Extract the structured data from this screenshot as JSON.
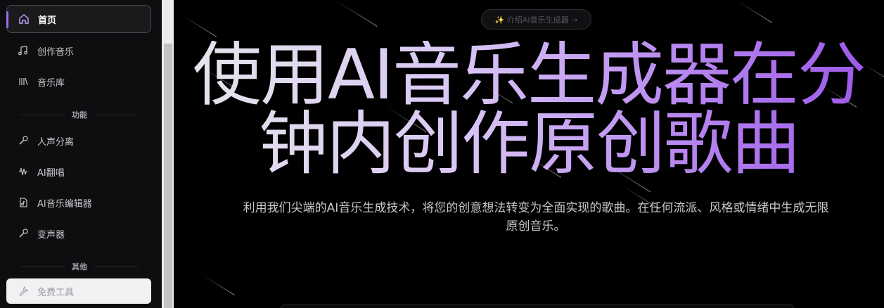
{
  "sidebar": {
    "nav": [
      {
        "label": "首页",
        "icon": "home-icon"
      },
      {
        "label": "创作音乐",
        "icon": "music-note-icon"
      },
      {
        "label": "音乐库",
        "icon": "library-icon"
      }
    ],
    "section_features": "功能",
    "features": [
      {
        "label": "人声分离",
        "icon": "split-icon"
      },
      {
        "label": "AI翻唱",
        "icon": "waveform-icon"
      },
      {
        "label": "AI音乐编辑器",
        "icon": "audio-file-icon"
      },
      {
        "label": "变声器",
        "icon": "voice-changer-icon"
      }
    ],
    "section_other": "其他",
    "other": [
      {
        "label": "免费工具",
        "icon": "wrench-icon"
      }
    ]
  },
  "hero": {
    "badge": "✨ 介绍AI音乐生成器 →",
    "title_line1": "使用AI音乐生成器在分",
    "title_line2": "钟内创作原创歌曲",
    "subtitle_line1": "利用我们尖端的AI音乐生成技术，将您的创意想法转变为全面实现的歌曲。在任何流派、风格或情绪中生成无限",
    "subtitle_line2": "原创音乐。"
  },
  "colors": {
    "accent": "#9b6cf0",
    "gradient_end": "#9a55e8"
  }
}
